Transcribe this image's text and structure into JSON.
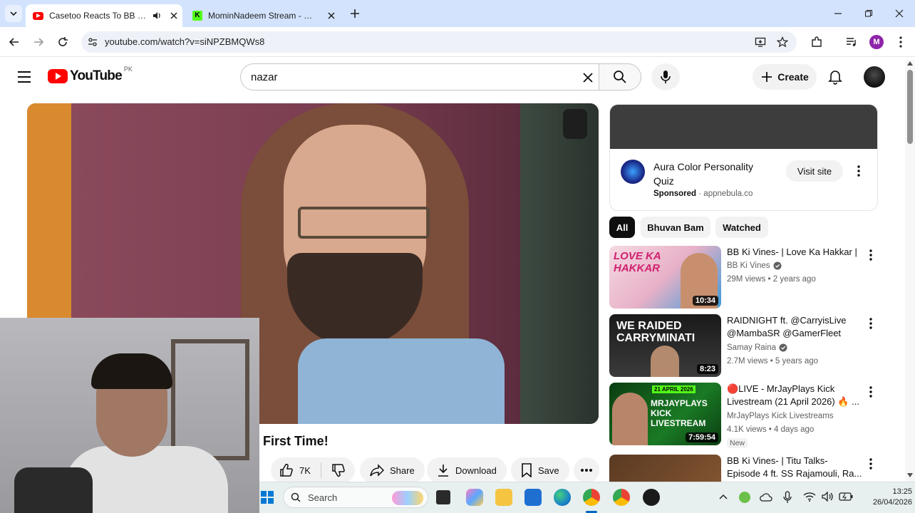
{
  "browser": {
    "tabs": [
      {
        "title": "Casetoo Reacts To BB ki Vin",
        "active": true
      },
      {
        "title": "MominNadeem Stream - Watch",
        "active": false
      }
    ],
    "url": "youtube.com/watch?v=siNPZBMQWs8",
    "profile_initial": "M"
  },
  "youtube": {
    "logo_text": "YouTube",
    "region": "PK",
    "search_value": "nazar",
    "create_label": "Create"
  },
  "video": {
    "title": "First Time!",
    "actions": {
      "likes": "7K",
      "share": "Share",
      "download": "Download",
      "save": "Save"
    }
  },
  "ad": {
    "title": "Aura Color Personality Quiz",
    "sponsored": "Sponsored",
    "domain": "appnebula.co",
    "cta": "Visit site"
  },
  "chips": [
    "All",
    "Bhuvan Bam",
    "Watched"
  ],
  "recommendations": [
    {
      "title": "BB Ki Vines- | Love Ka Hakkar |",
      "channel": "BB Ki Vines",
      "verified": true,
      "meta": "29M views • 2 years ago",
      "duration": "10:34",
      "thumb_text": "LOVE KA HAKKAR"
    },
    {
      "title": "RAIDNIGHT ft. @CarryisLive @MambaSR @GamerFleet",
      "channel": "Samay Raina",
      "verified": true,
      "meta": "2.7M views • 5 years ago",
      "duration": "8:23",
      "thumb_text": "WE RAIDED CARRYMINATI"
    },
    {
      "title": "🔴LIVE - MrJayPlays Kick Livestream (21 April 2026) 🔥 ...",
      "channel": "MrJayPlays Kick Livestreams",
      "verified": false,
      "meta": "4.1K views • 4 days ago",
      "duration": "7:59:54",
      "thumb_text": "MRJAYPLAYS KICK LIVESTREAM",
      "thumb_date": "21 APRIL 2026",
      "badge": "New"
    },
    {
      "title": "BB Ki Vines- | Titu Talks- Episode 4 ft. SS Rajamouli, Ra...",
      "channel": "",
      "verified": false,
      "meta": "",
      "duration": "",
      "thumb_text": ""
    }
  ],
  "taskbar": {
    "search_placeholder": "Search",
    "time": "13:25",
    "date": "26/04/2026"
  },
  "colors": {
    "youtube_red": "#ff0000",
    "tabstrip_bg": "#d3e3fd",
    "taskbar_bg": "#e7efef"
  }
}
